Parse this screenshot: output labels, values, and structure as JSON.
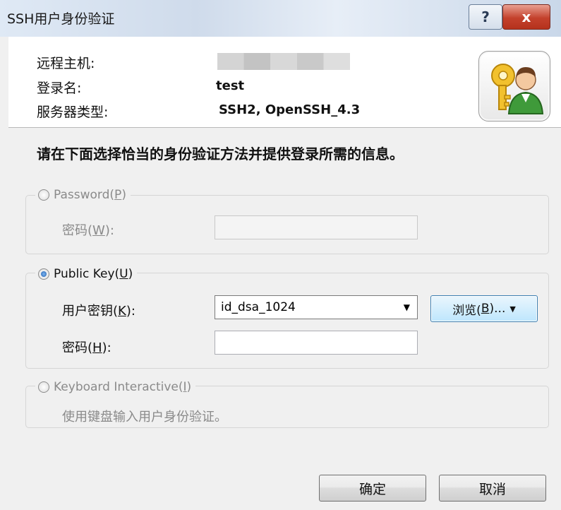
{
  "window": {
    "title": "SSH用户身份验证",
    "help_label": "?",
    "close_label": "x"
  },
  "header": {
    "host_label": "远程主机:",
    "host_value": "",
    "login_label": "登录名:",
    "login_value": "test",
    "server_type_label": "服务器类型:",
    "server_type_value": "SSH2, OpenSSH_4.3",
    "avatar_icon": "user-key-icon"
  },
  "instruction": "请在下面选择恰当的身份验证方法并提供登录所需的信息。",
  "password_group": {
    "radio_label": "Password(",
    "radio_key": "P",
    "radio_suffix": ")",
    "selected": false,
    "field_label": "密码(",
    "field_key": "W",
    "field_suffix": "):",
    "field_value": ""
  },
  "publickey_group": {
    "radio_label": "Public Key(",
    "radio_key": "U",
    "radio_suffix": ")",
    "selected": true,
    "key_label": "用户密钥(",
    "key_key": "K",
    "key_suffix": "):",
    "key_selected": "id_dsa_1024",
    "browse_label": "浏览(",
    "browse_key": "B",
    "browse_suffix": ")...",
    "pass_label": "密码(",
    "pass_key": "H",
    "pass_suffix": "):",
    "pass_value": ""
  },
  "keyboard_group": {
    "radio_label": "Keyboard Interactive(",
    "radio_key": "I",
    "radio_suffix": ")",
    "selected": false,
    "description": "使用键盘输入用户身份验证。"
  },
  "buttons": {
    "ok": "确定",
    "cancel": "取消"
  }
}
